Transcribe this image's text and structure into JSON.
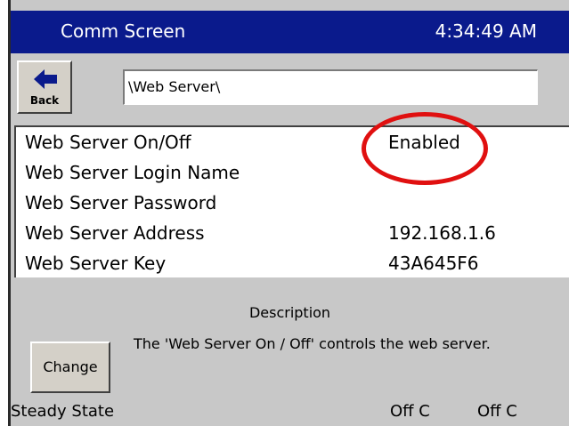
{
  "titlebar": {
    "title": "Comm Screen",
    "clock": "4:34:49 AM"
  },
  "nav": {
    "back_label": "Back",
    "path": "\\Web Server\\"
  },
  "settings": {
    "rows": [
      {
        "name": "Web Server On/Off",
        "value": "Enabled"
      },
      {
        "name": "Web Server Login Name",
        "value": ""
      },
      {
        "name": "Web Server Password",
        "value": ""
      },
      {
        "name": "Web Server Address",
        "value": "192.168.1.6"
      },
      {
        "name": "Web Server Key",
        "value": "43A645F6"
      }
    ]
  },
  "description": {
    "heading": "Description",
    "text": "The 'Web Server On / Off' controls the web server."
  },
  "actions": {
    "change_label": "Change"
  },
  "status": {
    "state": "Steady State",
    "value1": "Off C",
    "value2": "Off C"
  },
  "colors": {
    "titlebar": "#0a1a8c",
    "highlight": "#e01010",
    "panel": "#c8c8c8"
  },
  "icons": {
    "back": "arrow-left-icon"
  }
}
